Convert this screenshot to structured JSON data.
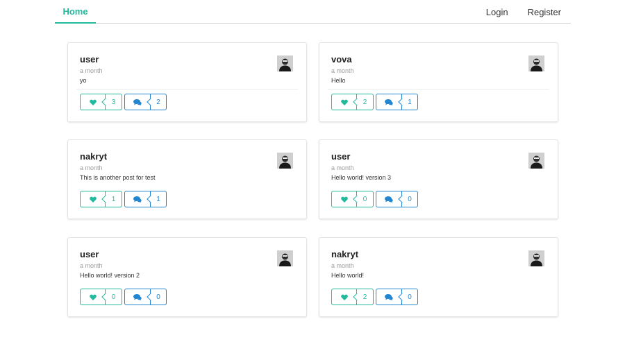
{
  "nav": {
    "home": "Home",
    "login": "Login",
    "register": "Register"
  },
  "posts": [
    {
      "author": "user",
      "meta": "a month",
      "desc": "yo",
      "likes": "3",
      "comments": "2"
    },
    {
      "author": "vova",
      "meta": "a month",
      "desc": "Hello",
      "likes": "2",
      "comments": "1"
    },
    {
      "author": "nakryt",
      "meta": "a month",
      "desc": "This is another post for test",
      "likes": "1",
      "comments": "1"
    },
    {
      "author": "user",
      "meta": "a month",
      "desc": "Hello world! version 3",
      "likes": "0",
      "comments": "0"
    },
    {
      "author": "user",
      "meta": "a month",
      "desc": "Hello world! version 2",
      "likes": "0",
      "comments": "0"
    },
    {
      "author": "nakryt",
      "meta": "a month",
      "desc": "Hello world!",
      "likes": "2",
      "comments": "0"
    }
  ],
  "icons": {
    "like": "heart-icon",
    "comment": "comments-icon"
  },
  "colors": {
    "accent": "#21ba9c",
    "comment": "#2185d0"
  }
}
